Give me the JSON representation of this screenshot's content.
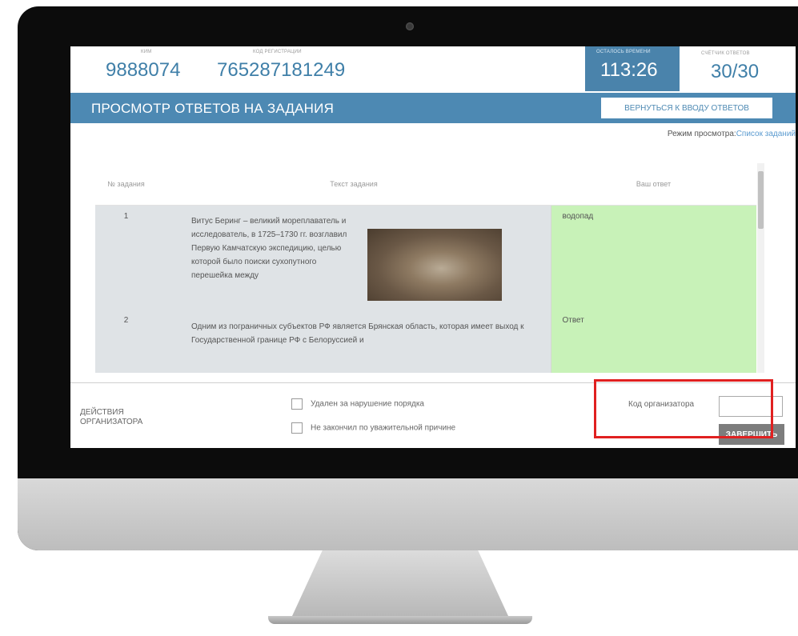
{
  "header": {
    "code_label": "КИМ",
    "code_value": "9888074",
    "registration_label": "КОД РЕГИСТРАЦИИ",
    "registration_value": "765287181249",
    "timer_label": "ОСТАЛОСЬ ВРЕМЕНИ",
    "timer_value": "113:26",
    "answers_label": "СЧЁТЧИК ОТВЕТОВ",
    "answers_value": "30/30"
  },
  "title_bar": {
    "title": "ПРОСМОТР ОТВЕТОВ НА ЗАДАНИЯ",
    "back_button": "ВЕРНУТЬСЯ К ВВОДУ ОТВЕТОВ"
  },
  "view_mode": {
    "label": "Режим просмотра:",
    "value": "Список заданий"
  },
  "table": {
    "col_num": "№ задания",
    "col_text": "Текст задания",
    "col_answer": "Ваш ответ",
    "rows": [
      {
        "num": "1",
        "text": "Витус Беринг – великий мореплаватель и исследователь, в 1725–1730 гг. возглавил Первую Камчатскую экспедицию, целью которой было поиски сухопутного перешейка между",
        "answer": "водопад"
      },
      {
        "num": "2",
        "text": "Одним из пограничных субъектов РФ является Брянская область, которая имеет выход к Государственной границе РФ с Белоруссией и",
        "answer": "Ответ"
      }
    ]
  },
  "organizer": {
    "label_line1": "ДЕЙСТВИЯ",
    "label_line2": "ОРГАНИЗАТОРА",
    "check1": "Удален за нарушение порядка",
    "check2": "Не закончил по уважительной причине",
    "code_label": "Код организатора",
    "finish_button": "ЗАВЕРШИТЬ"
  },
  "colors": {
    "accent": "#4d89b3",
    "answer_bg": "#c8f2b8",
    "highlight": "#e02020"
  }
}
